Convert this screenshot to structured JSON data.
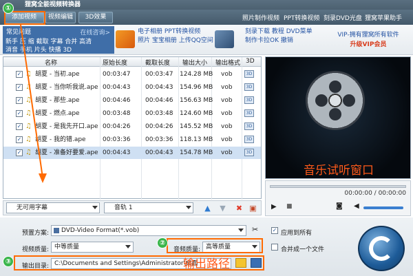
{
  "app": {
    "title": "狸窝全能视频转换器"
  },
  "menu": {
    "tabs": [
      {
        "label": "添加视频"
      },
      {
        "label": "视频编辑"
      },
      {
        "label": "3D效果"
      }
    ],
    "links": [
      {
        "label": "照片制作视频"
      },
      {
        "label": "PPT转换视频"
      },
      {
        "label": "刻录DVD光盘"
      },
      {
        "label": "狸窝苹果助手"
      }
    ]
  },
  "common": {
    "title": "常见问题",
    "consult": "在线咨询>",
    "row1": "新手  压  缩  截取  字幕  合并  高清",
    "row2": "消音  手机  片头  快播  3D"
  },
  "promos": [
    {
      "line1": "电子相册  PPT转换视频",
      "line2": "照片  宝宝相册  上传QQ空间"
    },
    {
      "line1": "刻录下载  教程  DVD菜单",
      "line2": "制作卡拉OK  撤销"
    }
  ],
  "vip": {
    "line1": "VIP-拥有狸窝所有软件",
    "line2": "升级VIP会员"
  },
  "list": {
    "headers": {
      "name": "名称",
      "length": "原始长度",
      "cut": "截取长度",
      "size": "输出大小",
      "format": "输出格式",
      "d3": "3D"
    },
    "rows": [
      {
        "name": "胡夏 - 当初.ape",
        "length": "00:03:47",
        "cut": "00:03:47",
        "size": "124.28 MB",
        "format": "vob"
      },
      {
        "name": "胡夏 - 当你听我说.ape",
        "length": "00:04:43",
        "cut": "00:04:43",
        "size": "154.96 MB",
        "format": "vob"
      },
      {
        "name": "胡夏 - 那些.ape",
        "length": "00:04:46",
        "cut": "00:04:46",
        "size": "156.63 MB",
        "format": "vob"
      },
      {
        "name": "胡夏 - 燃点.ape",
        "length": "00:03:48",
        "cut": "00:03:48",
        "size": "124.60 MB",
        "format": "vob"
      },
      {
        "name": "胡夏 - 是我先开口.ape",
        "length": "00:04:26",
        "cut": "00:04:26",
        "size": "145.52 MB",
        "format": "vob"
      },
      {
        "name": "胡夏 - 我的错.ape",
        "length": "00:03:36",
        "cut": "00:03:36",
        "size": "118.13 MB",
        "format": "vob"
      },
      {
        "name": "胡夏 - 准备好要爱.ape",
        "length": "00:04:43",
        "cut": "00:04:43",
        "size": "154.78 MB",
        "format": "vob"
      }
    ]
  },
  "list_tools": {
    "subtitle": "无可用字幕",
    "audio": "音轨 1"
  },
  "preview": {
    "overlay": "音乐试听窗口",
    "time": "00:00:00 / 00:00:00"
  },
  "form": {
    "preset_label": "预置方案:",
    "preset_value": "DVD-Video Format(*.vob)",
    "apply_all": "应用到所有",
    "video_quality_label": "视频质量:",
    "video_quality": "中等质量",
    "audio_quality_label": "音频质量:",
    "audio_quality": "高等质量",
    "merge": "合并成一个文件",
    "output_label": "输出目录:",
    "output_path": "C:\\Documents and Settings\\Administrator\\桌面",
    "output_overlay": "输出路径"
  },
  "badges": [
    "①",
    "②",
    "③"
  ],
  "colors": {
    "accent": "#ff6a00",
    "badge": "#39b54a",
    "brand": "#3f6ea8"
  }
}
